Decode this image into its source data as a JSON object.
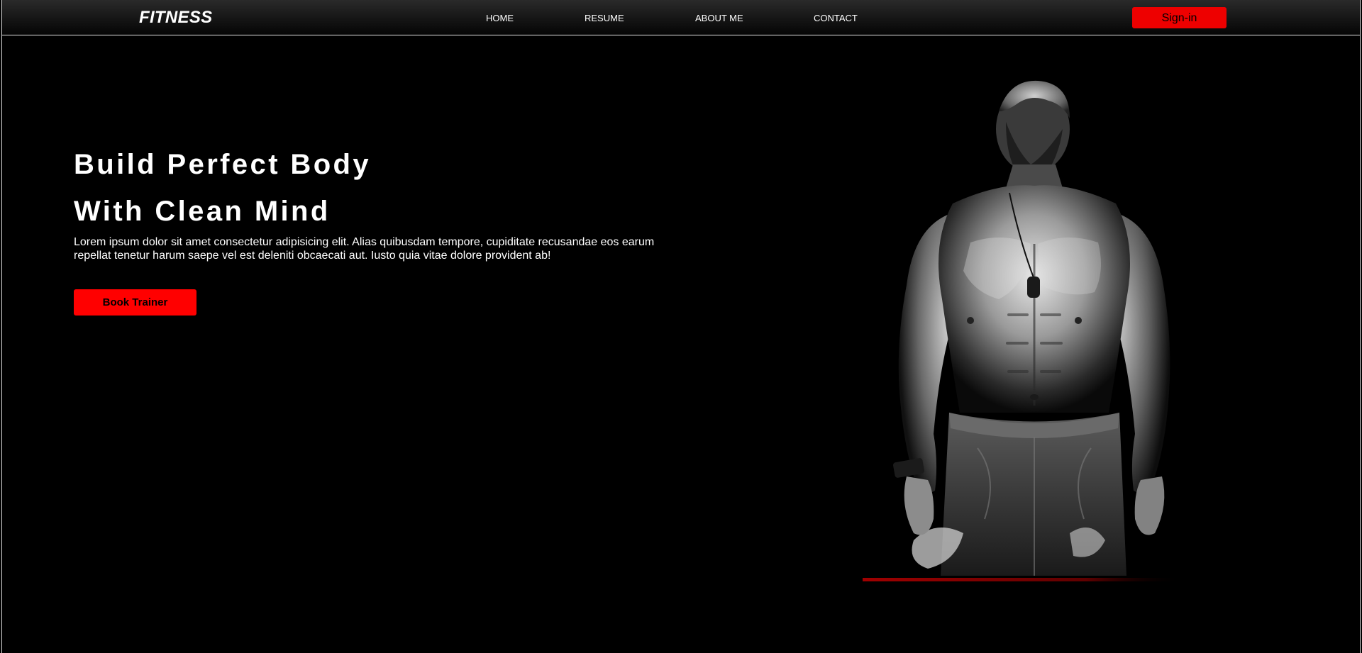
{
  "nav": {
    "logo": "FITNESS",
    "links": [
      "HOME",
      "RESUME",
      "ABOUT ME",
      "CONTACT"
    ],
    "signin_label": "Sign-in"
  },
  "hero": {
    "title_line1": "Build Perfect Body",
    "title_line2": "With Clean Mind",
    "description": "Lorem ipsum dolor sit amet consectetur adipisicing elit. Alias quibusdam tempore, cupiditate recusandae eos earum repellat tenetur harum saepe vel est deleniti obcaecati aut. Iusto quia vitae dolore provident ab!",
    "cta_label": "Book Trainer",
    "image": "muscular-man-portrait"
  },
  "colors": {
    "accent": "#ff0000",
    "background": "#000000",
    "text": "#ffffff"
  }
}
